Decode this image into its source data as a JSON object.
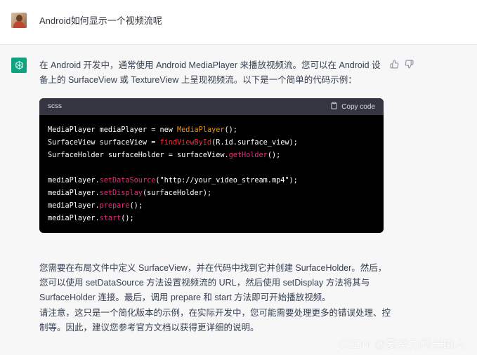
{
  "user": {
    "question": "Android如何显示一个视频流呢"
  },
  "assistant": {
    "intro_lines": [
      "在 Android 开发中，通常使用 Android MediaPlayer 来播放视频流。您可以在 Android 设",
      "备上的 SurfaceView 或 TextureView 上呈现视频流。以下是一个简单的代码示例："
    ],
    "code": {
      "language": "scss",
      "copy_label": "Copy code",
      "lines": [
        [
          {
            "t": "MediaPlayer mediaPlayer = new ",
            "c": "plain"
          },
          {
            "t": "MediaPlayer",
            "c": "orange"
          },
          {
            "t": "();",
            "c": "plain"
          }
        ],
        [
          {
            "t": "SurfaceView surfaceView = ",
            "c": "plain"
          },
          {
            "t": "findViewById",
            "c": "red"
          },
          {
            "t": "(R.id.surface_view);",
            "c": "plain"
          }
        ],
        [
          {
            "t": "SurfaceHolder surfaceHolder = surfaceView.",
            "c": "plain"
          },
          {
            "t": "getHolder",
            "c": "fn"
          },
          {
            "t": "();",
            "c": "plain"
          }
        ],
        [],
        [
          {
            "t": "mediaPlayer.",
            "c": "plain"
          },
          {
            "t": "setDataSource",
            "c": "fn"
          },
          {
            "t": "(\"http://your_video_stream.mp4\");",
            "c": "plain"
          }
        ],
        [
          {
            "t": "mediaPlayer.",
            "c": "plain"
          },
          {
            "t": "setDisplay",
            "c": "fn"
          },
          {
            "t": "(surfaceHolder);",
            "c": "plain"
          }
        ],
        [
          {
            "t": "mediaPlayer.",
            "c": "plain"
          },
          {
            "t": "prepare",
            "c": "fn"
          },
          {
            "t": "();",
            "c": "plain"
          }
        ],
        [
          {
            "t": "mediaPlayer.",
            "c": "plain"
          },
          {
            "t": "start",
            "c": "fn"
          },
          {
            "t": "();",
            "c": "plain"
          }
        ]
      ]
    },
    "explain_lines": [
      "您需要在布局文件中定义 SurfaceView，并在代码中找到它并创建 SurfaceHolder。然后，",
      "您可以使用 setDataSource 方法设置视频流的 URL，然后使用 setDisplay 方法将其与",
      "SurfaceHolder 连接。最后，调用 prepare 和 start 方法即可开始播放视频。"
    ],
    "note_lines": [
      "请注意，这只是一个简化版本的示例，在实际开发中，您可能需要处理更多的错误处理、控",
      "制等。因此，建议您参考官方文档以获得更详细的说明。"
    ]
  },
  "watermark": "CSDN @要努力闪光的人",
  "icons": {
    "user_avatar": "user-avatar-photo",
    "assistant_logo": "openai-logo-icon",
    "thumbs_up": "thumbs-up-icon",
    "thumbs_down": "thumbs-down-icon",
    "copy": "clipboard-icon"
  },
  "colors": {
    "assistant_avatar_bg": "#10a37f",
    "assistant_row_bg": "#f7f7f8",
    "code_bg": "#000000",
    "code_header_bg": "#343541"
  }
}
